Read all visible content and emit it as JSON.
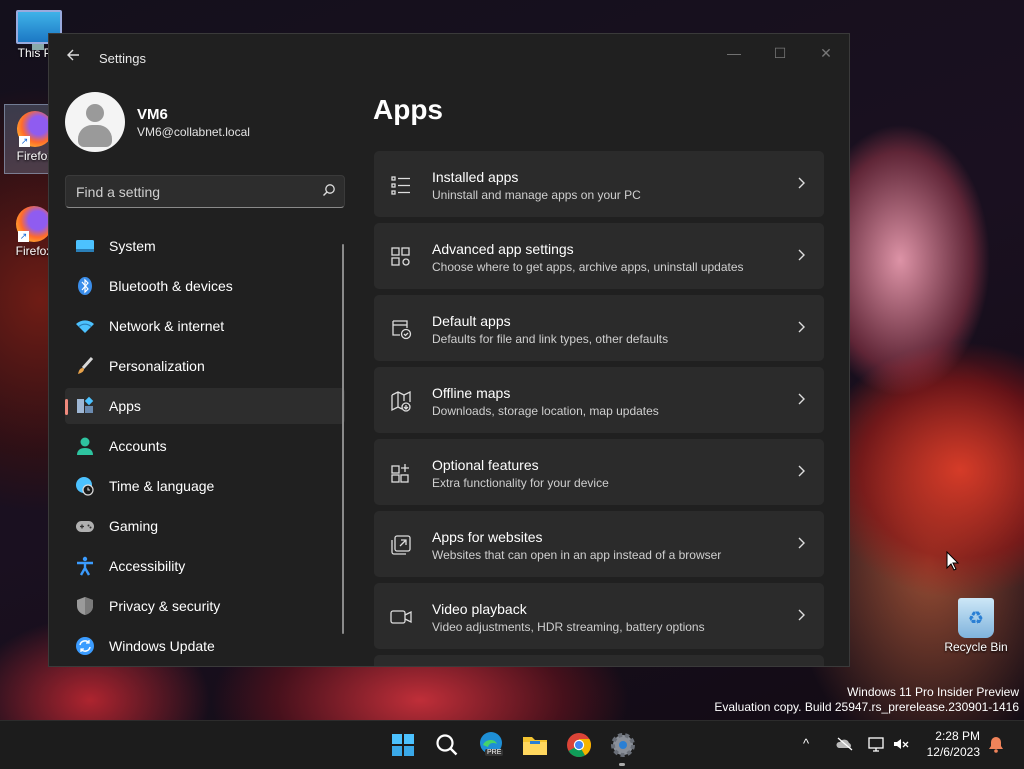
{
  "desktop": {
    "icons": [
      {
        "label": "This PC"
      },
      {
        "label": "Firefox"
      },
      {
        "label": "Firefox"
      }
    ],
    "recycle_bin": {
      "label": "Recycle Bin"
    },
    "watermark": {
      "line1": "Windows 11 Pro Insider Preview",
      "line2": "Evaluation copy. Build 25947.rs_prerelease.230901-1416"
    }
  },
  "window": {
    "title": "Settings",
    "controls": {
      "minimize": "—",
      "maximize": "☐",
      "close": "✕"
    }
  },
  "profile": {
    "name": "VM6",
    "email": "VM6@collabnet.local"
  },
  "search": {
    "placeholder": "Find a setting",
    "value": ""
  },
  "nav": {
    "items": [
      {
        "label": "System",
        "icon": "system-icon",
        "color": "#4cc2ff"
      },
      {
        "label": "Bluetooth & devices",
        "icon": "bluetooth-icon",
        "color": "#3b8eea"
      },
      {
        "label": "Network & internet",
        "icon": "network-icon",
        "color": "#4cc2ff"
      },
      {
        "label": "Personalization",
        "icon": "brush-icon",
        "color": "#e8a24a"
      },
      {
        "label": "Apps",
        "icon": "apps-icon",
        "color": "#9fb7d4",
        "active": true
      },
      {
        "label": "Accounts",
        "icon": "accounts-icon",
        "color": "#2ec4a0"
      },
      {
        "label": "Time & language",
        "icon": "globe-clock-icon",
        "color": "#4cc2ff"
      },
      {
        "label": "Gaming",
        "icon": "gamepad-icon",
        "color": "#b0b0b0"
      },
      {
        "label": "Accessibility",
        "icon": "accessibility-icon",
        "color": "#3b9cff"
      },
      {
        "label": "Privacy & security",
        "icon": "shield-icon",
        "color": "#9a9a9a"
      },
      {
        "label": "Windows Update",
        "icon": "update-icon",
        "color": "#3b9cff"
      }
    ]
  },
  "page": {
    "title": "Apps",
    "cards": [
      {
        "title": "Installed apps",
        "subtitle": "Uninstall and manage apps on your PC",
        "icon": "list-icon"
      },
      {
        "title": "Advanced app settings",
        "subtitle": "Choose where to get apps, archive apps, uninstall updates",
        "icon": "app-settings-icon"
      },
      {
        "title": "Default apps",
        "subtitle": "Defaults for file and link types, other defaults",
        "icon": "default-apps-icon"
      },
      {
        "title": "Offline maps",
        "subtitle": "Downloads, storage location, map updates",
        "icon": "map-icon"
      },
      {
        "title": "Optional features",
        "subtitle": "Extra functionality for your device",
        "icon": "optional-features-icon"
      },
      {
        "title": "Apps for websites",
        "subtitle": "Websites that can open in an app instead of a browser",
        "icon": "open-external-icon"
      },
      {
        "title": "Video playback",
        "subtitle": "Video adjustments, HDR streaming, battery options",
        "icon": "video-icon"
      }
    ]
  },
  "taskbar": {
    "apps": [
      "start-icon",
      "search-icon",
      "edge-icon",
      "file-explorer-icon",
      "chrome-icon",
      "settings-icon"
    ],
    "edge_badge": "PRE",
    "tray_chevron": "^",
    "clock": {
      "time": "2:28 PM",
      "date": "12/6/2023"
    }
  },
  "colors": {
    "accent": "#f08a7d",
    "window_bg": "#202020",
    "card_bg": "#2b2b2b"
  }
}
